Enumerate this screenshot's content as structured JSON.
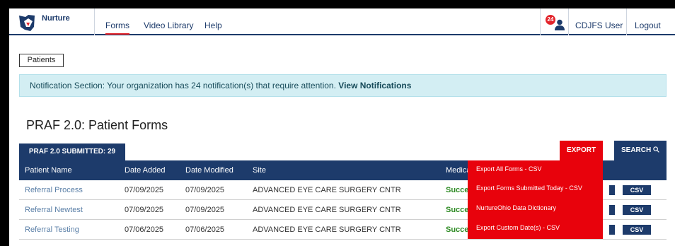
{
  "nav": {
    "brand": "Nurture",
    "links": [
      "Forms",
      "Video Library",
      "Help"
    ],
    "notification_count": "24",
    "user_name": "CDJFS User",
    "logout": "Logout"
  },
  "breadcrumb": {
    "patients": "Patients"
  },
  "alert": {
    "text": "Notification Section: Your organization has 24 notification(s) that require attention.",
    "link": "View Notifications"
  },
  "page_title": "PRAF 2.0: Patient Forms",
  "tab": {
    "label": "PRAF 2.0 SUBMITTED: 29"
  },
  "actions": {
    "export": "EXPORT",
    "search": "SEARCH"
  },
  "table": {
    "headers": [
      "Patient Name",
      "Date Added",
      "Date Modified",
      "Site",
      "Medica"
    ],
    "rows": [
      {
        "name": "Referral Process",
        "added": "07/09/2025",
        "modified": "07/09/2025",
        "site": "ADVANCED EYE CARE SURGERY CNTR",
        "status": "Succe",
        "csv": "CSV"
      },
      {
        "name": "Referral Newtest",
        "added": "07/09/2025",
        "modified": "07/09/2025",
        "site": "ADVANCED EYE CARE SURGERY CNTR",
        "status": "Succe",
        "csv": "CSV"
      },
      {
        "name": "Referral Testing",
        "added": "07/06/2025",
        "modified": "07/06/2025",
        "site": "ADVANCED EYE CARE SURGERY CNTR",
        "status": "Succe",
        "csv": "CSV"
      }
    ]
  },
  "export_menu": {
    "items": [
      "Export All Forms - CSV",
      "Export Forms Submitted Today - CSV",
      "NurtureOhio Data Dictionary",
      "Export Custom Date(s) - CSV"
    ]
  },
  "colors": {
    "navy": "#1d3b6b",
    "red": "#e8020c",
    "alert_bg": "#d3eef3",
    "success": "#2e8b24"
  }
}
